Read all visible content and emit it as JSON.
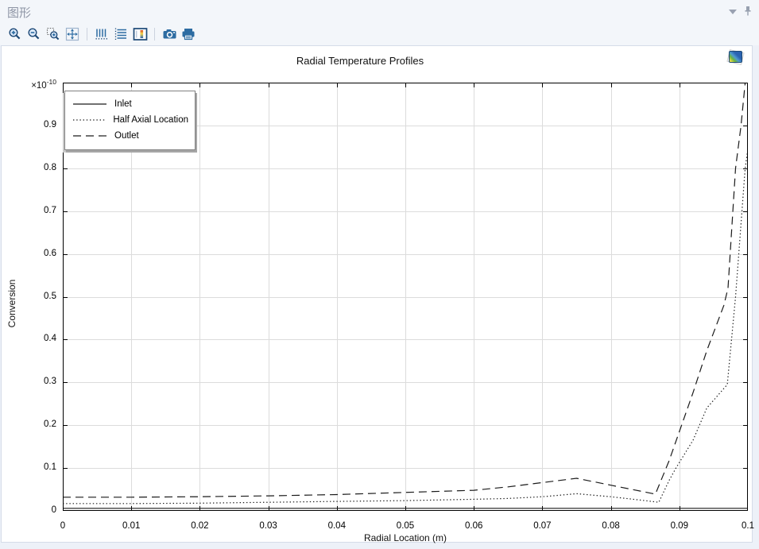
{
  "window": {
    "title": "图形"
  },
  "header_icons": [
    {
      "name": "chevron-down-icon"
    },
    {
      "name": "pin-icon"
    }
  ],
  "toolbar": {
    "icons": [
      {
        "name": "zoom-in-icon"
      },
      {
        "name": "zoom-out-icon"
      },
      {
        "name": "zoom-box-icon"
      },
      {
        "name": "zoom-extents-icon"
      },
      {
        "name": "x-axis-grid-icon"
      },
      {
        "name": "y-axis-grid-icon"
      },
      {
        "name": "color-legend-icon"
      },
      {
        "name": "image-snapshot-icon"
      },
      {
        "name": "print-icon"
      }
    ]
  },
  "plot_button": {
    "name": "plot-thumbnail-button"
  },
  "colors": {
    "accent_blue": "#2d6ca2",
    "navy": "#1d4977",
    "header_text": "#8e95a5",
    "grid": "#dcdcdc",
    "line": "#1a1a1a",
    "frame": "#000000",
    "panel_bg": "#ffffff",
    "chrome_bg": "#f3f6fa"
  },
  "chart_data": {
    "type": "line",
    "title": "Radial Temperature Profiles",
    "xlabel": "Radial Location (m)",
    "ylabel": "Conversion",
    "y_multiplier": "×10⁻¹⁰",
    "y_multiplier_base": "×10",
    "y_multiplier_exp": "-10",
    "xlim": [
      0,
      0.1
    ],
    "ylim": [
      0,
      1.0
    ],
    "x_ticks": [
      0,
      0.01,
      0.02,
      0.03,
      0.04,
      0.05,
      0.06,
      0.07,
      0.08,
      0.09,
      0.1
    ],
    "y_ticks": [
      0,
      0.1,
      0.2,
      0.3,
      0.4,
      0.5,
      0.6,
      0.7,
      0.8,
      0.9
    ],
    "grid": true,
    "legend_position": "top-left",
    "series": [
      {
        "name": "Inlet",
        "style": "solid",
        "points": [
          [
            0,
            0.006
          ],
          [
            0.1,
            0.006
          ]
        ]
      },
      {
        "name": "Half Axial Location",
        "style": "dotted",
        "points": [
          [
            0,
            0.017
          ],
          [
            0.005,
            0.017
          ],
          [
            0.01,
            0.017
          ],
          [
            0.02,
            0.018
          ],
          [
            0.03,
            0.02
          ],
          [
            0.04,
            0.022
          ],
          [
            0.05,
            0.024
          ],
          [
            0.06,
            0.027
          ],
          [
            0.065,
            0.029
          ],
          [
            0.07,
            0.033
          ],
          [
            0.075,
            0.04
          ],
          [
            0.08,
            0.033
          ],
          [
            0.085,
            0.024
          ],
          [
            0.087,
            0.02
          ],
          [
            0.0885,
            0.071
          ],
          [
            0.0895,
            0.1
          ],
          [
            0.092,
            0.165
          ],
          [
            0.094,
            0.24
          ],
          [
            0.097,
            0.295
          ],
          [
            0.0982,
            0.5
          ],
          [
            0.0996,
            0.8
          ],
          [
            0.1,
            0.845
          ]
        ]
      },
      {
        "name": "Outlet",
        "style": "dashed",
        "points": [
          [
            0,
            0.032
          ],
          [
            0.005,
            0.032
          ],
          [
            0.01,
            0.032
          ],
          [
            0.02,
            0.033
          ],
          [
            0.03,
            0.035
          ],
          [
            0.04,
            0.038
          ],
          [
            0.05,
            0.043
          ],
          [
            0.06,
            0.048
          ],
          [
            0.065,
            0.056
          ],
          [
            0.07,
            0.066
          ],
          [
            0.075,
            0.076
          ],
          [
            0.08,
            0.06
          ],
          [
            0.085,
            0.044
          ],
          [
            0.0865,
            0.039
          ],
          [
            0.0885,
            0.117
          ],
          [
            0.092,
            0.276
          ],
          [
            0.094,
            0.374
          ],
          [
            0.0965,
            0.48
          ],
          [
            0.0971,
            0.52
          ],
          [
            0.0982,
            0.8
          ],
          [
            0.099,
            0.9
          ],
          [
            0.0996,
            1.0
          ]
        ]
      }
    ]
  }
}
